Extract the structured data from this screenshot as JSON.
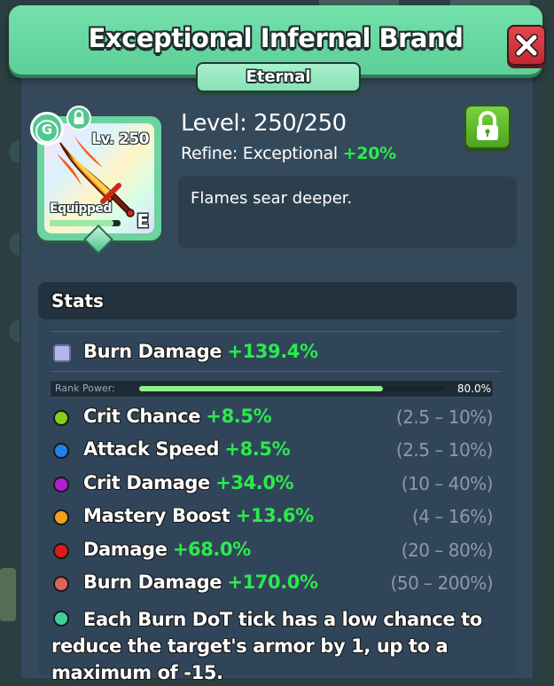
{
  "item": {
    "name": "Exceptional Infernal Brand",
    "rarity": "Eternal",
    "level_text": "Level: 250/250",
    "refine_label": "Refine: Exceptional",
    "refine_bonus": "+20%",
    "description": "Flames sear deeper.",
    "card": {
      "level": "Lv. 250",
      "equipped_label": "Equipped",
      "grade": "E",
      "badge_letter": "G",
      "progress": 0.9
    }
  },
  "stats": {
    "title": "Stats",
    "main_stat": {
      "label": "Burn Damage",
      "value": "+139.4%",
      "icon": "burn-damage-icon"
    },
    "rank_power": {
      "label": "Rank Power:",
      "value_text": "80.0%",
      "fill": 0.8
    },
    "sub_stats": [
      {
        "label": "Crit Chance",
        "value": "+8.5%",
        "range": "(2.5 – 10%)",
        "color": "#7fd11f"
      },
      {
        "label": "Attack Speed",
        "value": "+8.5%",
        "range": "(2.5 – 10%)",
        "color": "#1f82f0"
      },
      {
        "label": "Crit Damage",
        "value": "+34.0%",
        "range": "(10 – 40%)",
        "color": "#b01fd3"
      },
      {
        "label": "Mastery Boost",
        "value": "+13.6%",
        "range": "(4 – 16%)",
        "color": "#f0a01a"
      },
      {
        "label": "Damage",
        "value": "+68.0%",
        "range": "(20 – 80%)",
        "color": "#e01a1a"
      },
      {
        "label": "Burn Damage",
        "value": "+170.0%",
        "range": "(50 – 200%)",
        "color": "#e0625e"
      }
    ],
    "special": {
      "text": "Each Burn DoT tick has a low chance to reduce the target's armor by 1, up to a maximum of -15.",
      "color": "#3fcf9a"
    }
  },
  "colors": {
    "header": "#5ccf97",
    "value_green": "#2bea4c",
    "panel": "#34495a"
  }
}
